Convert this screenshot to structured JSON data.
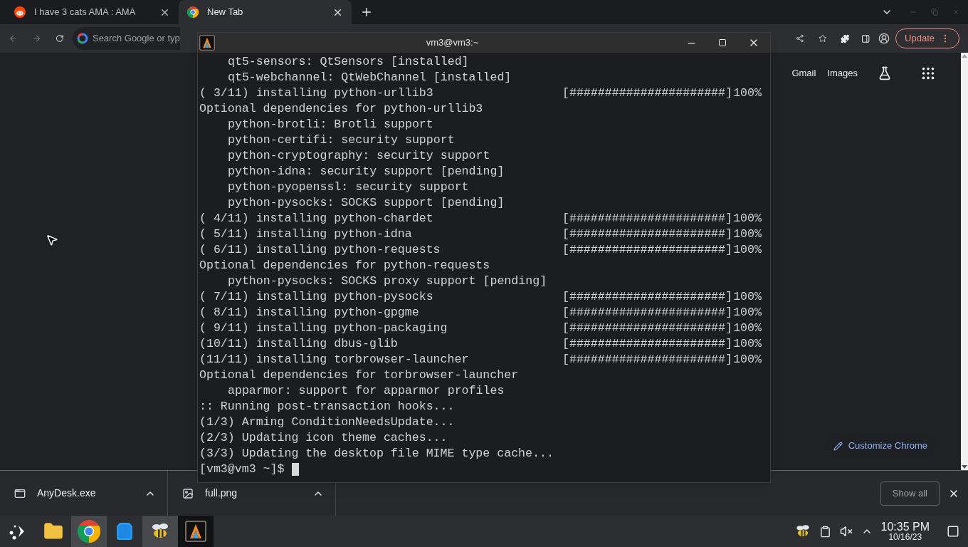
{
  "browser": {
    "tabs": [
      {
        "title": "I have 3 cats AMA : AMA",
        "kind": "reddit",
        "selected": false
      },
      {
        "title": "New Tab",
        "kind": "chrome",
        "selected": true
      }
    ],
    "omnibox": {
      "placeholder": "Search Google or typ"
    },
    "update_button": "Update",
    "page": {
      "links": [
        "Gmail",
        "Images"
      ],
      "customize_button": "Customize Chrome"
    },
    "downloads": {
      "items": [
        {
          "name": "AnyDesk.exe",
          "kind": "exe"
        },
        {
          "name": "full.png",
          "kind": "image"
        }
      ],
      "show_all": "Show all"
    }
  },
  "terminal": {
    "title": "vm3@vm3:~",
    "lines": [
      {
        "kind": "indented",
        "text": "qt5-sensors: QtSensors [installed]"
      },
      {
        "kind": "indented",
        "text": "qt5-webchannel: QtWebChannel [installed]"
      },
      {
        "kind": "progress",
        "text": "( 3/11) installing python-urllib3",
        "bar": "[######################]",
        "percent": "100%"
      },
      {
        "kind": "plain",
        "text": "Optional dependencies for python-urllib3"
      },
      {
        "kind": "indented",
        "text": "python-brotli: Brotli support"
      },
      {
        "kind": "indented",
        "text": "python-certifi: security support"
      },
      {
        "kind": "indented",
        "text": "python-cryptography: security support"
      },
      {
        "kind": "indented",
        "text": "python-idna: security support [pending]"
      },
      {
        "kind": "indented",
        "text": "python-pyopenssl: security support"
      },
      {
        "kind": "indented",
        "text": "python-pysocks: SOCKS support [pending]"
      },
      {
        "kind": "progress",
        "text": "( 4/11) installing python-chardet",
        "bar": "[######################]",
        "percent": "100%"
      },
      {
        "kind": "progress",
        "text": "( 5/11) installing python-idna",
        "bar": "[######################]",
        "percent": "100%"
      },
      {
        "kind": "progress",
        "text": "( 6/11) installing python-requests",
        "bar": "[######################]",
        "percent": "100%"
      },
      {
        "kind": "plain",
        "text": "Optional dependencies for python-requests"
      },
      {
        "kind": "indented",
        "text": "python-pysocks: SOCKS proxy support [pending]"
      },
      {
        "kind": "progress",
        "text": "( 7/11) installing python-pysocks",
        "bar": "[######################]",
        "percent": "100%"
      },
      {
        "kind": "progress",
        "text": "( 8/11) installing python-gpgme",
        "bar": "[######################]",
        "percent": "100%"
      },
      {
        "kind": "progress",
        "text": "( 9/11) installing python-packaging",
        "bar": "[######################]",
        "percent": "100%"
      },
      {
        "kind": "progress",
        "text": "(10/11) installing dbus-glib",
        "bar": "[######################]",
        "percent": "100%"
      },
      {
        "kind": "progress",
        "text": "(11/11) installing torbrowser-launcher",
        "bar": "[######################]",
        "percent": "100%"
      },
      {
        "kind": "plain",
        "text": "Optional dependencies for torbrowser-launcher"
      },
      {
        "kind": "indented",
        "text": "apparmor: support for apparmor profiles"
      },
      {
        "kind": "plain",
        "text": ":: Running post-transaction hooks..."
      },
      {
        "kind": "plain",
        "text": "(1/3) Arming ConditionNeedsUpdate..."
      },
      {
        "kind": "plain",
        "text": "(2/3) Updating icon theme caches..."
      },
      {
        "kind": "plain",
        "text": "(3/3) Updating the desktop file MIME type cache..."
      },
      {
        "kind": "prompt",
        "text": "[vm3@vm3 ~]$"
      }
    ]
  },
  "taskbar": {
    "apps": [
      {
        "kind": "start",
        "active": false
      },
      {
        "kind": "folder",
        "active": false
      },
      {
        "kind": "chrome",
        "active": true
      },
      {
        "kind": "store",
        "active": false
      },
      {
        "kind": "bee",
        "active": true
      },
      {
        "kind": "terminal",
        "active": true
      }
    ],
    "time": "10:35 PM",
    "date": "10/16/23"
  }
}
